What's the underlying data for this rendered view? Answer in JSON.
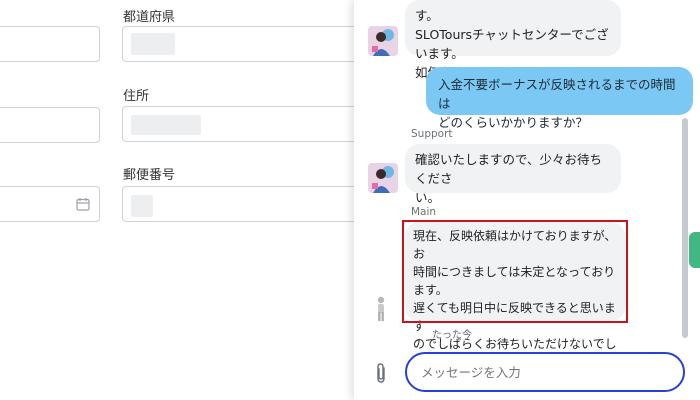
{
  "form": {
    "prefecture_label": "都道府県",
    "address_label": "住所",
    "postal_label": "郵便番号"
  },
  "chat": {
    "messages": [
      {
        "text": "す。\nSLOToursチャットセンターでございます。\n如何なさいましたか？"
      },
      {
        "text": "入金不要ボーナスが反映されるまでの時間は\nどのくらいかかりますか？"
      },
      {
        "sender": "Support",
        "text": "確認いたしますので、少々お待ちくださ\nい。"
      },
      {
        "sender": "Main",
        "text": "現在、反映依頼はかけておりますが、お\n時間につきましては未定となっております。\n遅くても明日中に反映できると思います\nのでしばらくお待ちいただけないでしょ\nうか。"
      }
    ],
    "timestamp": "たった今",
    "composer_placeholder": "メッセージを入力"
  },
  "colors": {
    "outgoing_bubble": "#7cc8f4",
    "incoming_bubble": "#f1f2f4",
    "highlight": "#c8141e",
    "composer_border": "#2a3fd6"
  }
}
